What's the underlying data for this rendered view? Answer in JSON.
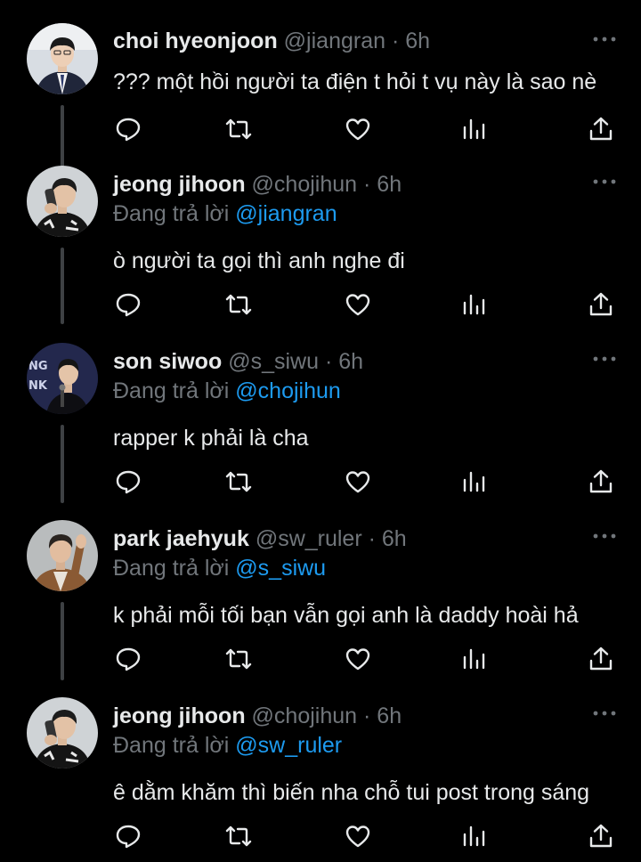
{
  "tweets": [
    {
      "name": "choi hyeonjoon",
      "handle": "@jiangran",
      "time": "6h",
      "reply_prefix": "",
      "reply_to": "",
      "text": "??? một hồi người ta điện t hỏi t vụ này là sao nè",
      "avatar_icon": "avatar-person-suit-white",
      "avatar_bg": "#d8dde3"
    },
    {
      "name": "jeong jihoon",
      "handle": "@chojihun",
      "time": "6h",
      "reply_prefix": "Đang trả lời ",
      "reply_to": "@jiangran",
      "text": "ò người ta gọi thì anh nghe đi",
      "avatar_icon": "avatar-person-jersey-phone",
      "avatar_bg": "#cfd3d6"
    },
    {
      "name": "son siwoo",
      "handle": "@s_siwu",
      "time": "6h",
      "reply_prefix": "Đang trả lời ",
      "reply_to": "@chojihun",
      "text": "rapper k phải là cha",
      "avatar_icon": "avatar-person-stage-mic",
      "avatar_bg": "#1c2140"
    },
    {
      "name": "park jaehyuk",
      "handle": "@sw_ruler",
      "time": "6h",
      "reply_prefix": "Đang trả lời ",
      "reply_to": "@s_siwu",
      "text": "k phải mỗi tối bạn vẫn gọi anh là daddy hoài hả",
      "avatar_icon": "avatar-person-waving-jacket",
      "avatar_bg": "#b9bcbd"
    },
    {
      "name": "jeong jihoon",
      "handle": "@chojihun",
      "time": "6h",
      "reply_prefix": "Đang trả lời ",
      "reply_to": "@sw_ruler",
      "text": "ê dằm khăm thì biến nha chỗ tui post trong sáng",
      "avatar_icon": "avatar-person-jersey-phone",
      "avatar_bg": "#cfd3d6"
    }
  ],
  "separator": "·",
  "action_icons": [
    "reply-icon",
    "retweet-icon",
    "like-icon",
    "views-icon",
    "share-icon"
  ],
  "more_icon": "more-options-icon",
  "colors": {
    "background": "#000000",
    "text": "#e7e9ea",
    "secondary": "#71767b",
    "mention": "#1d9bf0",
    "thread_line": "#3e4144"
  }
}
